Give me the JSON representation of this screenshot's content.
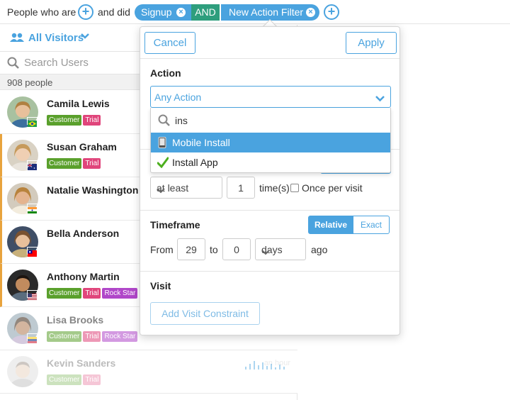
{
  "topbar": {
    "prefix": "People who are",
    "middle": "and did",
    "chip_signup": "Signup",
    "chip_and": "AND",
    "chip_filter": "New Action Filter",
    "remove_glyph": "×"
  },
  "sidebar": {
    "visitors_label": "All Visitors",
    "search_placeholder": "Search Users",
    "count": "908 people",
    "users": [
      {
        "name": "Camila Lewis",
        "tags": [
          "Customer",
          "Trial"
        ],
        "flag": "brazil"
      },
      {
        "name": "Susan Graham",
        "tags": [
          "Customer",
          "Trial"
        ],
        "flag": "australia"
      },
      {
        "name": "Natalie Washington",
        "tags": [],
        "flag": "india"
      },
      {
        "name": "Bella Anderson",
        "tags": [],
        "flag": "taiwan"
      },
      {
        "name": "Anthony Martin",
        "tags": [
          "Customer",
          "Trial",
          "Rock Star"
        ],
        "flag": "usa"
      },
      {
        "name": "Lisa Brooks",
        "tags": [
          "Customer",
          "Trial",
          "Rock Star"
        ],
        "flag": "venezuela"
      },
      {
        "name": "Kevin Sanders",
        "tags": [
          "Customer",
          "Trial"
        ],
        "flag": "",
        "time": "an hour"
      }
    ]
  },
  "popover": {
    "cancel_label": "Cancel",
    "apply_label": "Apply",
    "action_title": "Action",
    "action_value": "Any Action",
    "search_query": "ins",
    "options": [
      {
        "label": "Mobile Install",
        "icon": "phone-icon",
        "selected": true
      },
      {
        "label": "Install App",
        "icon": "checkmark-icon",
        "selected": false
      }
    ],
    "frequency_select": "at least",
    "frequency_count": "1",
    "times_label": "time(s)",
    "once_per_visit_label": "Once per visit",
    "timeframe_title": "Timeframe",
    "relative_label": "Relative",
    "exact_label": "Exact",
    "from_label": "From",
    "from_value": "29",
    "to_label": "to",
    "to_value": "0",
    "unit_select": "days",
    "ago_label": "ago",
    "visit_title": "Visit",
    "add_visit_label": "Add Visit Constraint"
  },
  "colors": {
    "accent": "#4aa3df",
    "and_chip": "#2e9e7d",
    "customer_tag": "#5aa02c",
    "trial_tag": "#e0457b",
    "rockstar_tag": "#b047c9",
    "row_marker": "#e8a33d"
  }
}
